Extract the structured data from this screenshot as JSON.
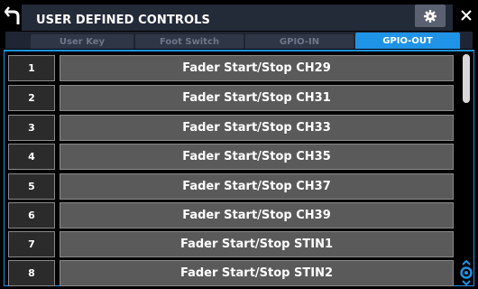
{
  "title": "USER DEFINED CONTROLS",
  "icons": {
    "back": "back-arrow-icon",
    "settings": "gear-icon",
    "close": "close-icon",
    "scroll": "scroll-updown-icon"
  },
  "colors": {
    "accent": "#1f93e6",
    "function_button": "#5a5a5a",
    "title_background": "#232a38"
  },
  "tabs": [
    {
      "label": "User Key",
      "active": false
    },
    {
      "label": "Foot Switch",
      "active": false
    },
    {
      "label": "GPIO-IN",
      "active": false
    },
    {
      "label": "GPIO-OUT",
      "active": true
    }
  ],
  "rows": [
    {
      "number": "1",
      "function": "Fader Start/Stop CH29"
    },
    {
      "number": "2",
      "function": "Fader Start/Stop CH31"
    },
    {
      "number": "3",
      "function": "Fader Start/Stop CH33"
    },
    {
      "number": "4",
      "function": "Fader Start/Stop CH35"
    },
    {
      "number": "5",
      "function": "Fader Start/Stop CH37"
    },
    {
      "number": "6",
      "function": "Fader Start/Stop CH39"
    },
    {
      "number": "7",
      "function": "Fader Start/Stop STIN1"
    },
    {
      "number": "8",
      "function": "Fader Start/Stop STIN2"
    }
  ]
}
